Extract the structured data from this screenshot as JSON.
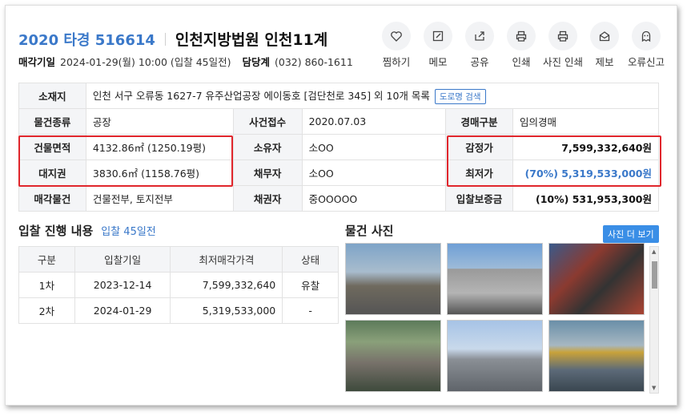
{
  "header": {
    "case_number": "2020 타경 516614",
    "court": "인천지방법원 인천11계",
    "sale_date_label": "매각기일",
    "sale_date_value": "2024-01-29(월) 10:00 (입찰 45일전)",
    "dept_label": "담당계",
    "dept_phone": "(032) 860-1611"
  },
  "toolbar": [
    {
      "label": "찜하기",
      "icon": "heart-icon"
    },
    {
      "label": "메모",
      "icon": "memo-icon"
    },
    {
      "label": "공유",
      "icon": "share-icon"
    },
    {
      "label": "인쇄",
      "icon": "print-icon"
    },
    {
      "label": "사진 인쇄",
      "icon": "photo-print-icon"
    },
    {
      "label": "제보",
      "icon": "mail-icon"
    },
    {
      "label": "오류신고",
      "icon": "ghost-icon"
    }
  ],
  "info": {
    "location_label": "소재지",
    "location_value": "인천 서구 오류동 1627-7 유주산업공장 에이동호 [검단천로 345] 외 10개 목록",
    "road_search": "도로명 검색",
    "type_label": "물건종류",
    "type_value": "공장",
    "received_label": "사건접수",
    "received_value": "2020.07.03",
    "auction_type_label": "경매구분",
    "auction_type_value": "임의경매",
    "building_area_label": "건물면적",
    "building_area_value": "4132.86㎡ (1250.19평)",
    "owner_label": "소유자",
    "owner_value": "소OO",
    "appraisal_label": "감정가",
    "appraisal_value": "7,599,332,640원",
    "land_label": "대지권",
    "land_value": "3830.6㎡ (1158.76평)",
    "debtor_label": "채무자",
    "debtor_value": "소OO",
    "min_price_label": "최저가",
    "min_price_value": "(70%) 5,319,533,000원",
    "sale_object_label": "매각물건",
    "sale_object_value": "건물전부, 토지전부",
    "creditor_label": "채권자",
    "creditor_value": "중OOOOO",
    "deposit_label": "입찰보증금",
    "deposit_value": "(10%) 531,953,300원"
  },
  "bid": {
    "title": "입찰 진행 내용",
    "subtitle": "입찰 45일전",
    "columns": [
      "구분",
      "입찰기일",
      "최저매각가격",
      "상태"
    ],
    "rows": [
      [
        "1차",
        "2023-12-14",
        "7,599,332,640",
        "유찰"
      ],
      [
        "2차",
        "2024-01-29",
        "5,319,533,000",
        "-"
      ]
    ]
  },
  "photos": {
    "title": "물건 사진",
    "more_button": "사진 더 보기"
  }
}
